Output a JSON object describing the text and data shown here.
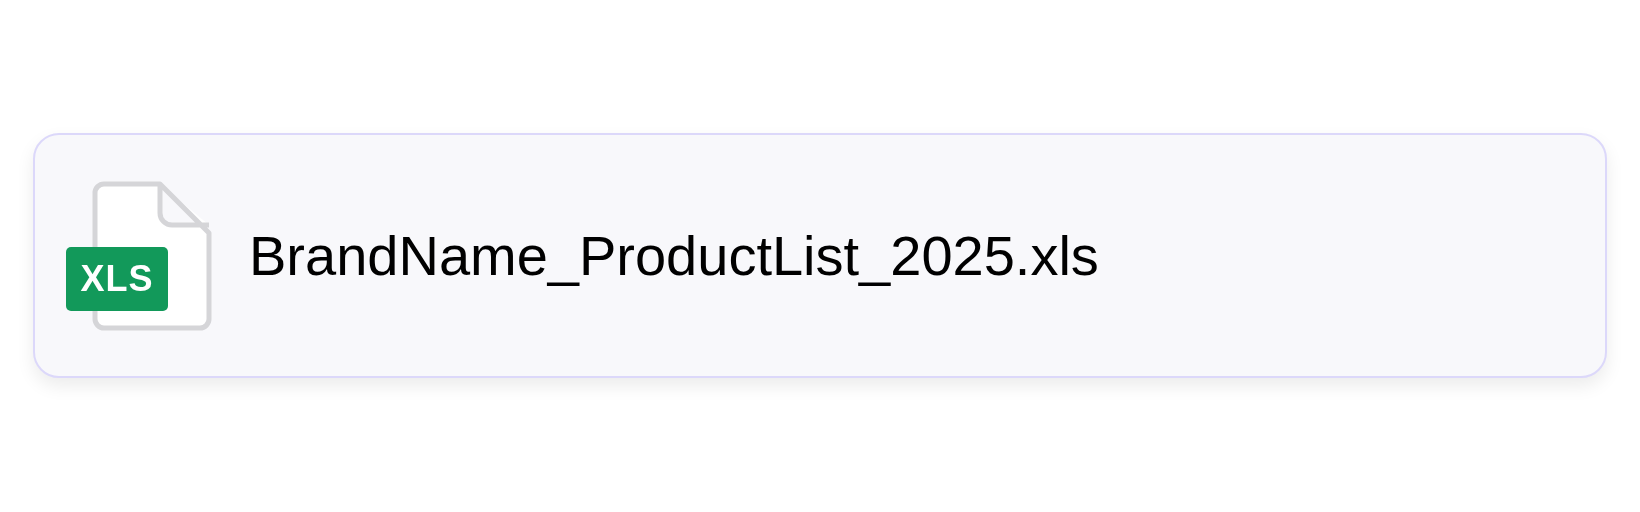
{
  "file": {
    "badge": "XLS",
    "name": "BrandName_ProductList_2025.xls"
  }
}
